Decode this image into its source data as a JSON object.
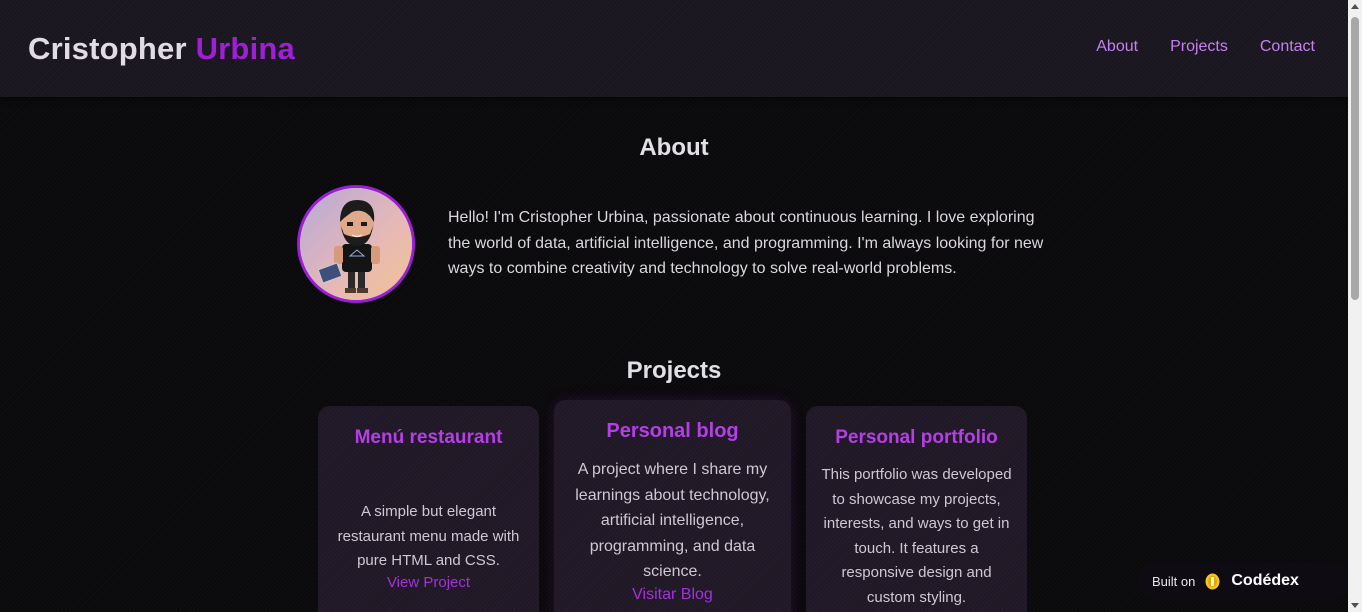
{
  "header": {
    "brand_first": "Cristopher",
    "brand_accent": "Urbina",
    "nav": [
      {
        "label": "About"
      },
      {
        "label": "Projects"
      },
      {
        "label": "Contact"
      }
    ]
  },
  "about": {
    "title": "About",
    "avatar_icon": "avatar-illustration",
    "text": "Hello! I'm Cristopher Urbina, passionate about continuous learning. I love exploring the world of data, artificial intelligence, and programming. I'm always looking for new ways to combine creativity and technology to solve real-world problems."
  },
  "projects": {
    "title": "Projects",
    "items": [
      {
        "title": "Menú restaurant",
        "description": "A simple but elegant restaurant menu made with pure HTML and CSS.",
        "link": "View Project"
      },
      {
        "title": "Personal blog",
        "description": "A project where I share my learnings about technology, artificial intelligence, programming, and data science.",
        "link": "Visitar Blog"
      },
      {
        "title": "Personal portfolio",
        "description": "This portfolio was developed to showcase my projects, interests, and ways to get in touch. It features a responsive design and custom styling."
      }
    ]
  },
  "badge": {
    "text": "Built on",
    "brand": "Codédex",
    "icon": "codedex-coin-icon"
  },
  "colors": {
    "accent": "#a01ed6",
    "link": "#c480ef",
    "card_title": "#b53fe6",
    "background": "#0a090b",
    "header": "#1a1620",
    "card": "#201826"
  }
}
